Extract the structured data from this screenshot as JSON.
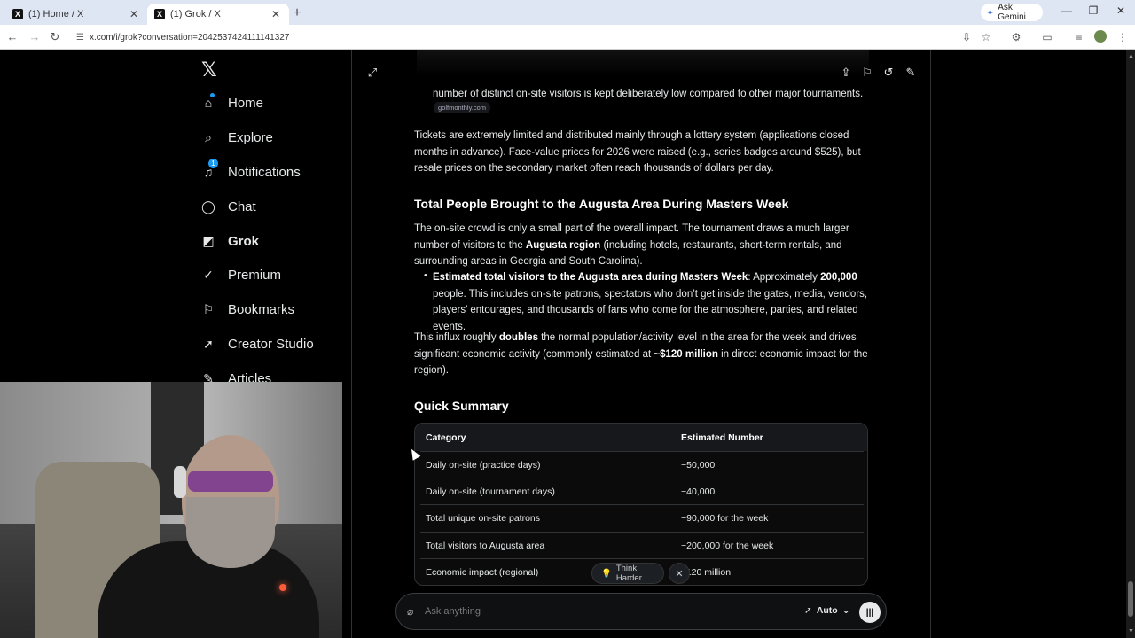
{
  "browser": {
    "tabs": [
      {
        "title": "(1) Home / X",
        "close": "✕"
      },
      {
        "title": "(1) Grok / X",
        "close": "✕"
      }
    ],
    "new_tab": "+",
    "gemini_label": "Ask Gemini",
    "url": "x.com/i/grok?conversation=2042537424111141327",
    "window_controls": [
      "—",
      "❐",
      "✕"
    ]
  },
  "nav": {
    "logo": "𝕏",
    "items": [
      {
        "label": "Home",
        "icon": "home-icon"
      },
      {
        "label": "Explore",
        "icon": "search-icon"
      },
      {
        "label": "Notifications",
        "icon": "bell-icon",
        "badge": "1"
      },
      {
        "label": "Chat",
        "icon": "chat-icon"
      },
      {
        "label": "Grok",
        "icon": "grok-icon"
      },
      {
        "label": "Premium",
        "icon": "premium-icon"
      },
      {
        "label": "Bookmarks",
        "icon": "bookmark-icon"
      },
      {
        "label": "Creator Studio",
        "icon": "rocket-icon"
      },
      {
        "label": "Articles",
        "icon": "articles-icon"
      }
    ]
  },
  "content": {
    "p0": "number of distinct on-site visitors is kept deliberately low compared to other major tournaments.",
    "source_chip": "golfmonthly.com",
    "p1": "Tickets are extremely limited and distributed mainly through a lottery system (applications closed months in advance). Face-value prices for 2026 were raised (e.g., series badges around $525), but resale prices on the secondary market often reach thousands of dollars per day.",
    "h_total": "Total People Brought to the Augusta Area During Masters Week",
    "p2_a": "The on-site crowd is only a small part of the overall impact. The tournament draws a much larger number of visitors to the ",
    "p2_b": "Augusta region",
    "p2_c": " (including hotels, restaurants, short-term rentals, and surrounding areas in Georgia and South Carolina).",
    "bullet_a": "Estimated total visitors to the Augusta area during Masters Week",
    "bullet_b": ": Approximately ",
    "bullet_c": "200,000",
    "bullet_d": " people. This includes on-site patrons, spectators who don’t get inside the gates, media, vendors, players’ entourages, and thousands of fans who come for the atmosphere, parties, and related events.",
    "p3_a": "This influx roughly ",
    "p3_b": "doubles",
    "p3_c": " the normal population/activity level in the area for the week and drives significant economic activity (commonly estimated at ~",
    "p3_d": "$120 million",
    "p3_e": " in direct economic impact for the region).",
    "h_summary": "Quick Summary"
  },
  "table": {
    "headers": [
      "Category",
      "Estimated Number"
    ],
    "rows": [
      [
        "Daily on-site (practice days)",
        "~50,000"
      ],
      [
        "Daily on-site (tournament days)",
        "~40,000"
      ],
      [
        "Total unique on-site patrons",
        "~90,000 for the week"
      ],
      [
        "Total visitors to Augusta area",
        "~200,000 for the week"
      ],
      [
        "Economic impact (regional)",
        "$120 million"
      ]
    ]
  },
  "chip": {
    "think_harder": "Think Harder",
    "close": "✕"
  },
  "composer": {
    "placeholder": "Ask anything",
    "mode": "Auto"
  }
}
